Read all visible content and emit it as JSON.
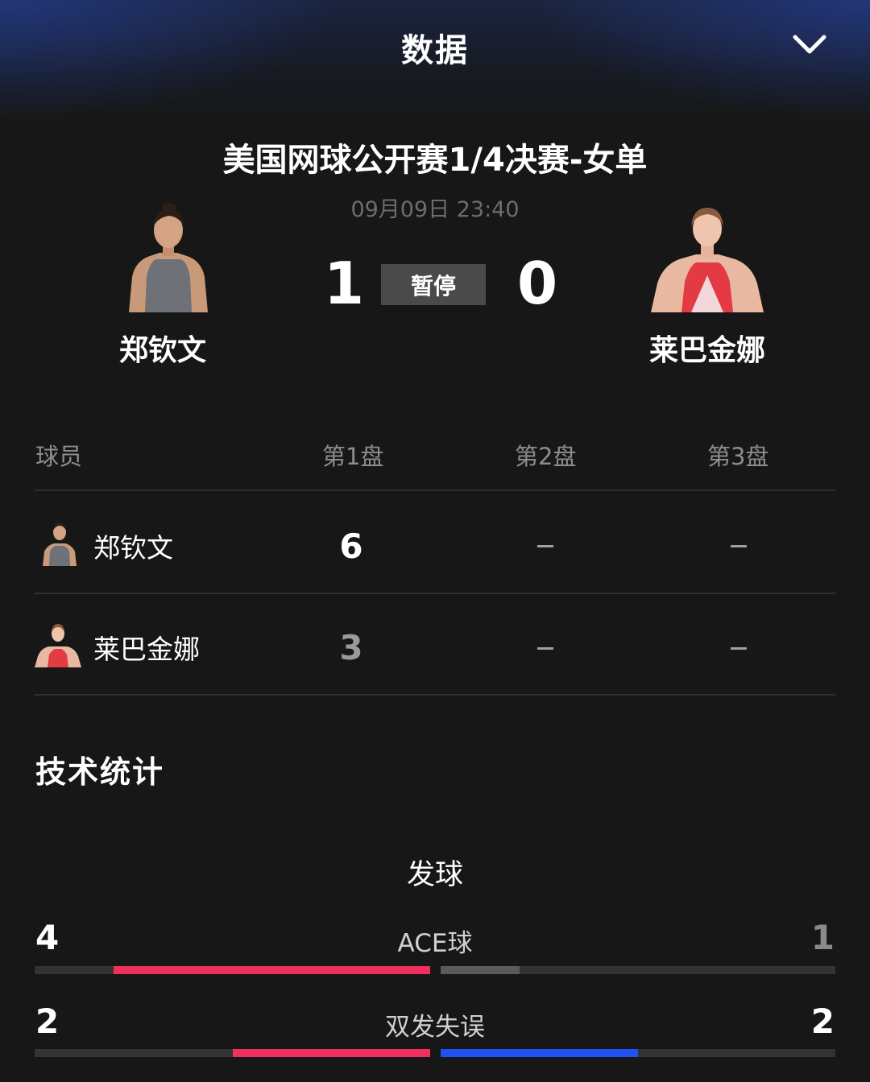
{
  "header": {
    "title": "数据"
  },
  "match": {
    "title": "美国网球公开赛1/4决赛-女单",
    "datetime": "09月09日 23:40",
    "status": "暂停",
    "home": {
      "name": "郑钦文",
      "sets_won": "1"
    },
    "away": {
      "name": "莱巴金娜",
      "sets_won": "0"
    }
  },
  "set_table": {
    "headers": [
      "球员",
      "第1盘",
      "第2盘",
      "第3盘"
    ],
    "rows": [
      {
        "name": "郑钦文",
        "scores": [
          "6",
          "–",
          "–"
        ]
      },
      {
        "name": "莱巴金娜",
        "scores": [
          "3",
          "–",
          "–"
        ]
      }
    ]
  },
  "tech_stats": {
    "title": "技术统计",
    "group": "发球",
    "items": [
      {
        "label": "ACE球",
        "home": "4",
        "away": "1",
        "home_share": 0.8,
        "away_share": 0.2,
        "home_color": "#f0305a",
        "away_color": "#5a5a5a"
      },
      {
        "label": "双发失误",
        "home": "2",
        "away": "2",
        "home_share": 0.5,
        "away_share": 0.5,
        "home_color": "#f0305a",
        "away_color": "#1f52f0"
      }
    ]
  },
  "colors": {
    "accent_red": "#f0305a",
    "accent_blue": "#1f52f0",
    "background": "#171717"
  }
}
